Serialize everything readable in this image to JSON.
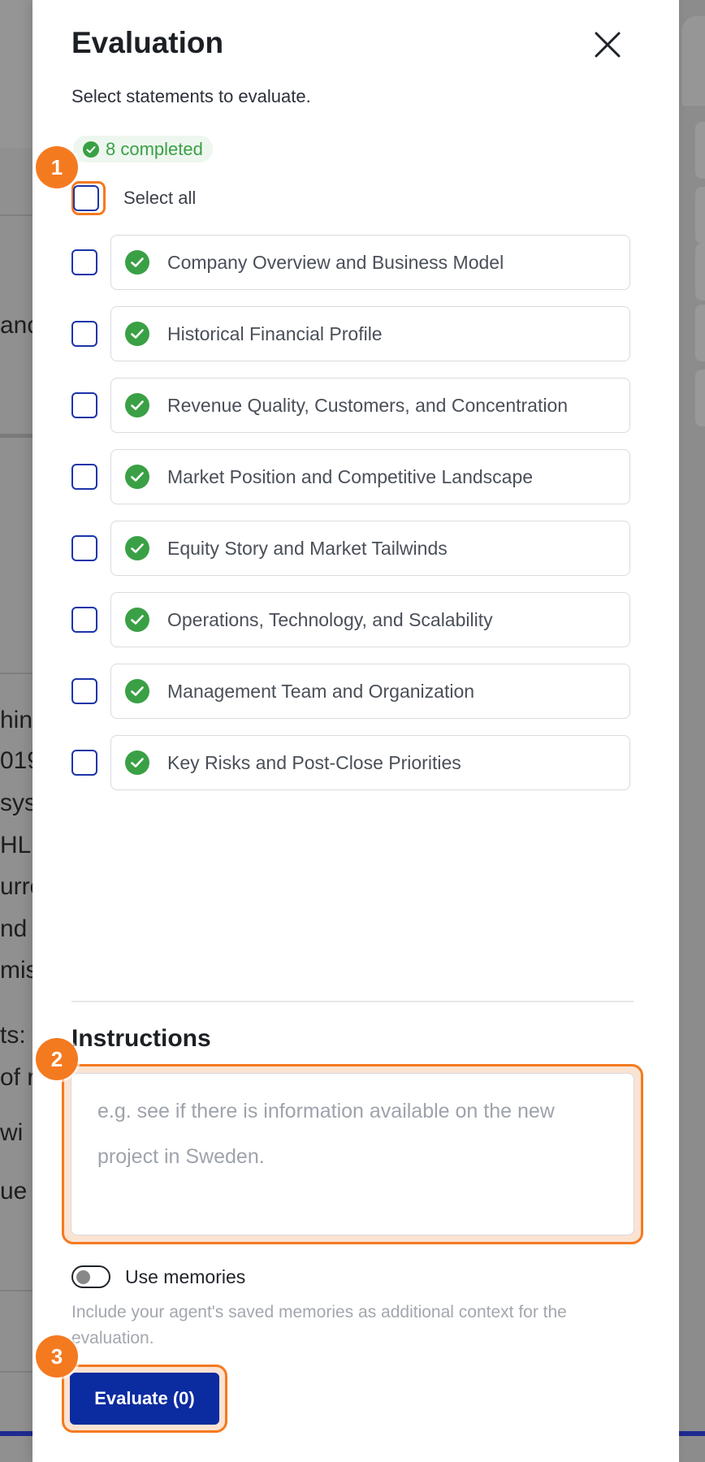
{
  "background": {
    "text_fragments": [
      "anc",
      "hin",
      "019",
      "sys",
      "HL",
      "urre",
      "nd",
      "mis",
      "ts:",
      "of r",
      "wi",
      "ue v"
    ]
  },
  "drawer": {
    "title": "Evaluation",
    "subtitle": "Select statements to evaluate.",
    "completed_badge": "8 completed",
    "select_all_label": "Select all",
    "statements": [
      {
        "label": "Company Overview and Business Model",
        "checked": false,
        "status": "completed"
      },
      {
        "label": "Historical Financial Profile",
        "checked": false,
        "status": "completed"
      },
      {
        "label": "Revenue Quality, Customers, and Concentration",
        "checked": false,
        "status": "completed"
      },
      {
        "label": "Market Position and Competitive Landscape",
        "checked": false,
        "status": "completed"
      },
      {
        "label": "Equity Story and Market Tailwinds",
        "checked": false,
        "status": "completed"
      },
      {
        "label": "Operations, Technology, and Scalability",
        "checked": false,
        "status": "completed"
      },
      {
        "label": "Management Team and Organization",
        "checked": false,
        "status": "completed"
      },
      {
        "label": "Key Risks and Post-Close Priorities",
        "checked": false,
        "status": "completed"
      }
    ],
    "instructions": {
      "title": "Instructions",
      "placeholder": "e.g. see if there is information available on the new project in Sweden.",
      "value": ""
    },
    "memories": {
      "label": "Use memories",
      "enabled": false,
      "description": "Include your agent's saved memories as additional context for the evaluation."
    },
    "evaluate_button": "Evaluate (0)"
  },
  "annotations": {
    "badge_1": "1",
    "badge_2": "2",
    "badge_3": "3"
  },
  "colors": {
    "accent_orange": "#f47a20",
    "primary_blue": "#0b2ba0",
    "checkbox_blue": "#1a35a8",
    "success_green": "#3aa045"
  }
}
